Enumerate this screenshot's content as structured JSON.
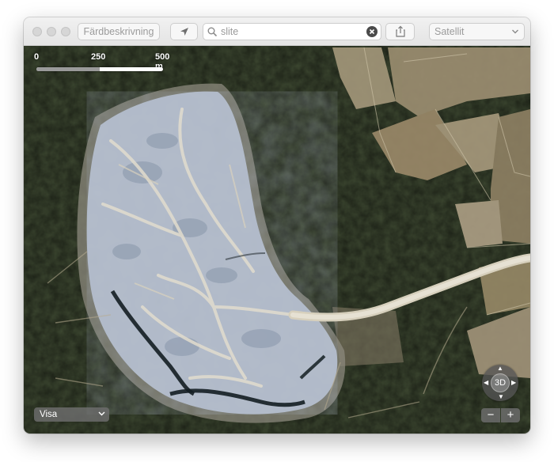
{
  "toolbar": {
    "directions_label": "Färdbeskrivning",
    "search_value": "slite",
    "map_type_selected": "Satellit"
  },
  "map": {
    "scale": {
      "labels": [
        "0",
        "250",
        "500 m"
      ]
    },
    "visa_label": "Visa",
    "view_3d_label": "3D",
    "zoom_out_label": "−",
    "zoom_in_label": "+"
  },
  "icons": {
    "location": "location-arrow-icon",
    "search": "magnifier-icon",
    "clear": "clear-x-icon",
    "share": "share-icon",
    "chevron": "chevron-down-icon"
  }
}
